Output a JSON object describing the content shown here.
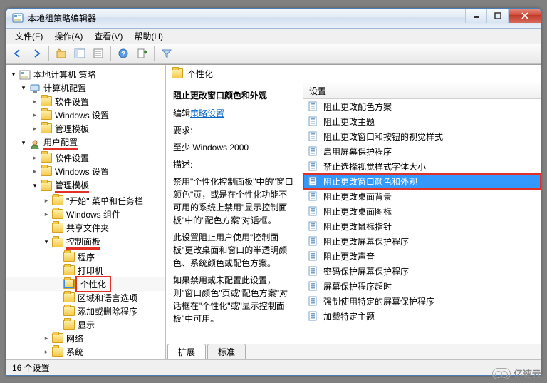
{
  "window": {
    "title": "本地组策略编辑器"
  },
  "menubar": {
    "file": "文件(F)",
    "action": "操作(A)",
    "view": "查看(V)",
    "help": "帮助(H)"
  },
  "tree": {
    "root": "本地计算机 策略",
    "computer": "计算机配置",
    "comp_soft": "软件设置",
    "comp_win": "Windows 设置",
    "comp_admin": "管理模板",
    "user": "用户配置",
    "user_soft": "软件设置",
    "user_win": "Windows 设置",
    "user_admin": "管理模板",
    "start_taskbar": "\"开始\" 菜单和任务栏",
    "win_comp": "Windows 组件",
    "share": "共享文件夹",
    "control_panel": "控制面板",
    "programs": "程序",
    "printers": "打印机",
    "personalize": "个性化",
    "region_lang": "区域和语言选项",
    "add_remove": "添加或删除程序",
    "display": "显示",
    "network": "网络",
    "system": "系统"
  },
  "crumb": {
    "label": "个性化"
  },
  "detail": {
    "heading": "阻止更改窗口颜色和外观",
    "edit_prefix": "编辑",
    "edit_link": "策略设置",
    "req_label": "要求:",
    "req_value": "至少 Windows 2000",
    "desc_label": "描述:",
    "desc_p1": "禁用\"个性化控制面板\"中的\"窗口颜色\"页，或是在个性化功能不可用的系统上禁用\"显示控制面板\"中的\"配色方案\"对话框。",
    "desc_p2": "此设置阻止用户使用\"控制面板\"更改桌面和窗口的半透明颜色、系统颜色或配色方案。",
    "desc_p3": "如果禁用或未配置此设置，则\"窗口颜色\"页或\"配色方案\"对话框在\"个性化\"或\"显示控制面板\"中可用。"
  },
  "list": {
    "header": "设置",
    "items": [
      "阻止更改配色方案",
      "阻止更改主题",
      "阻止更改窗口和按钮的视觉样式",
      "启用屏幕保护程序",
      "禁止选择视觉样式字体大小",
      "阻止更改窗口颜色和外观",
      "阻止更改桌面背景",
      "阻止更改桌面图标",
      "阻止更改鼠标指针",
      "阻止更改屏幕保护程序",
      "阻止更改声音",
      "密码保护屏幕保护程序",
      "屏幕保护程序超时",
      "强制使用特定的屏幕保护程序",
      "加载特定主题"
    ],
    "selected_index": 5
  },
  "tabs": {
    "expand": "扩展",
    "standard": "标准"
  },
  "statusbar": {
    "text": "16 个设置"
  },
  "watermark": "亿速云"
}
